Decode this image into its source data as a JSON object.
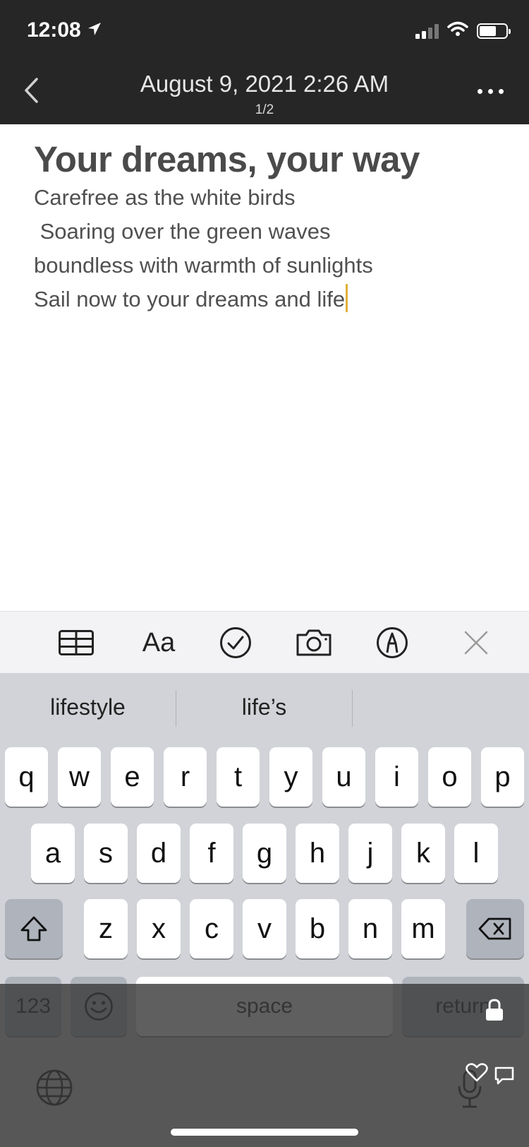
{
  "status_bar": {
    "time": "12:08",
    "location_icon": "location-arrow-icon",
    "signal_icon": "cellular-signal-icon",
    "wifi_icon": "wifi-icon",
    "battery_icon": "battery-icon"
  },
  "nav": {
    "back_icon": "chevron-left-icon",
    "title": "August 9, 2021 2:26 AM",
    "page_indicator": "1/2",
    "more_icon": "ellipsis-icon"
  },
  "note": {
    "title": "Your dreams, your way",
    "lines": [
      "Carefree as the white birds",
      " Soaring over the green waves",
      "boundless with warmth of sunlights",
      "Sail now to your dreams and life"
    ],
    "caret_color": "#e0b13a"
  },
  "toolbar": {
    "table_icon": "table-icon",
    "format_label": "Aa",
    "checklist_icon": "checkmark-circle-icon",
    "camera_icon": "camera-icon",
    "markup_icon": "markup-pen-icon",
    "close_icon": "close-icon"
  },
  "keyboard": {
    "suggestions": [
      "lifestyle",
      "life’s",
      ""
    ],
    "row1": [
      "q",
      "w",
      "e",
      "r",
      "t",
      "y",
      "u",
      "i",
      "o",
      "p"
    ],
    "row2": [
      "a",
      "s",
      "d",
      "f",
      "g",
      "h",
      "j",
      "k",
      "l"
    ],
    "row3": [
      "z",
      "x",
      "c",
      "v",
      "b",
      "n",
      "m"
    ],
    "numbers_label": "123",
    "space_label": "space",
    "return_label": "return",
    "shift_icon": "shift-icon",
    "delete_icon": "delete-backspace-icon",
    "emoji_icon": "emoji-icon",
    "globe_icon": "globe-icon",
    "mic_icon": "microphone-icon"
  },
  "colors": {
    "nav_bg": "#262626",
    "keyboard_bg": "#d1d3d8",
    "toolbar_bg": "#f3f3f5"
  }
}
